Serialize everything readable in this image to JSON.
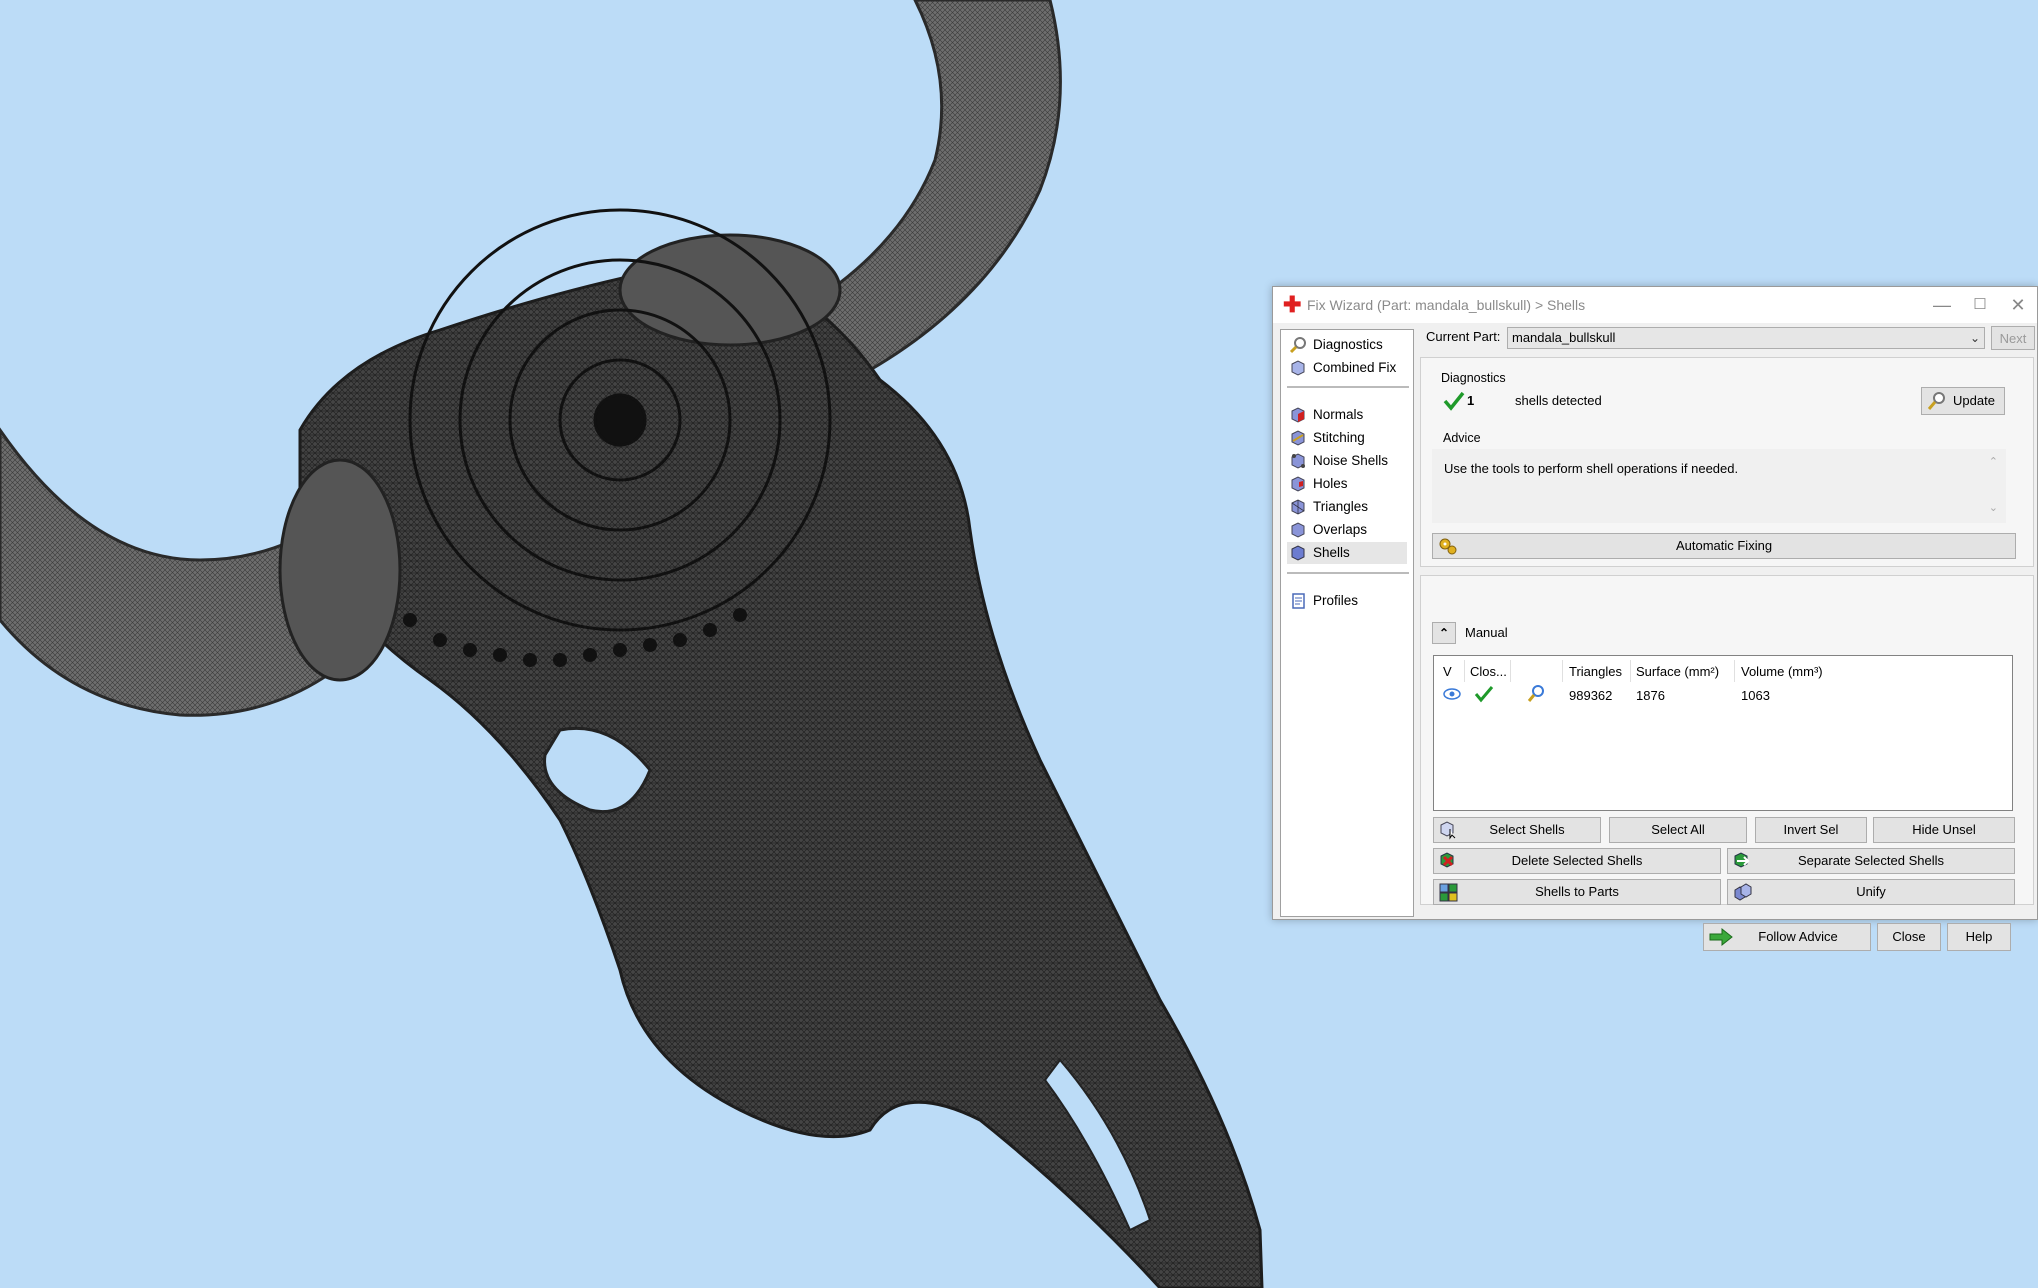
{
  "window": {
    "title": "Fix Wizard (Part: mandala_bullskull) > Shells",
    "minimize": "—",
    "maximize": "☐",
    "close": "✕"
  },
  "nav": {
    "items": [
      {
        "label": "Diagnostics",
        "icon": "magnifier-icon"
      },
      {
        "label": "Combined Fix",
        "icon": "cube-icon"
      },
      {
        "label": "Normals",
        "icon": "normals-cube-icon"
      },
      {
        "label": "Stitching",
        "icon": "stitching-cube-icon"
      },
      {
        "label": "Noise Shells",
        "icon": "noise-shells-icon"
      },
      {
        "label": "Holes",
        "icon": "holes-cube-icon"
      },
      {
        "label": "Triangles",
        "icon": "triangles-cube-icon"
      },
      {
        "label": "Overlaps",
        "icon": "overlaps-cube-icon"
      },
      {
        "label": "Shells",
        "icon": "shells-cube-icon"
      },
      {
        "label": "Profiles",
        "icon": "document-icon"
      }
    ],
    "selected": "Shells"
  },
  "current_part": {
    "label": "Current Part:",
    "value": "mandala_bullskull",
    "next_label": "Next"
  },
  "diagnostics": {
    "title": "Diagnostics",
    "count": "1",
    "text": "shells detected",
    "update_label": "Update"
  },
  "advice": {
    "title": "Advice",
    "text": "Use the tools to perform shell operations if needed."
  },
  "automatic_fixing_label": "Automatic Fixing",
  "manual": {
    "title": "Manual",
    "columns": [
      "V",
      "Clos...",
      "",
      "Triangles",
      "Surface (mm²)",
      "Volume (mm³)"
    ],
    "rows": [
      {
        "triangles": "989362",
        "surface": "1876",
        "volume": "1063"
      }
    ]
  },
  "buttons": {
    "select_shells": "Select Shells",
    "select_all": "Select All",
    "invert_sel": "Invert Sel",
    "hide_unsel": "Hide Unsel",
    "delete_selected": "Delete Selected Shells",
    "separate_selected": "Separate Selected Shells",
    "shells_to_parts": "Shells to Parts",
    "unify": "Unify",
    "follow_advice": "Follow Advice",
    "close": "Close",
    "help": "Help"
  },
  "colors": {
    "viewport_bg": "#bcdcf7",
    "mesh": "#3a3a3a",
    "title_icon": "#e02020",
    "check": "#1f9a2a"
  }
}
